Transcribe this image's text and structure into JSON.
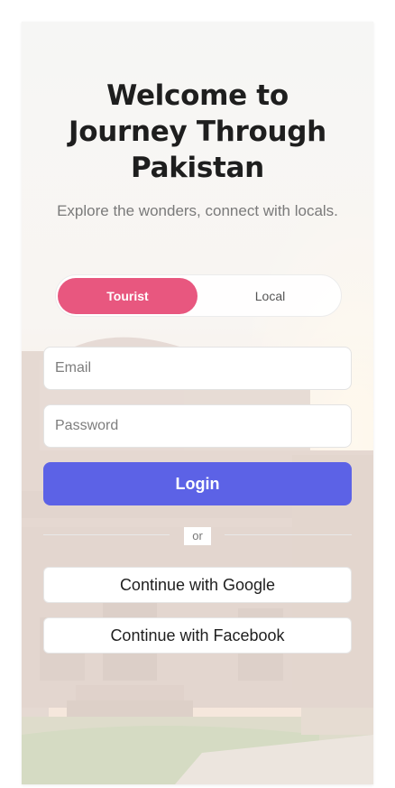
{
  "header": {
    "title_line1": "Welcome to",
    "title_line2": "Journey Through",
    "title_line3": "Pakistan",
    "subtitle": "Explore the wonders, connect with locals."
  },
  "role_toggle": {
    "tourist_label": "Tourist",
    "local_label": "Local",
    "selected": "Tourist"
  },
  "form": {
    "email_placeholder": "Email",
    "password_placeholder": "Password",
    "login_label": "Login",
    "divider_text": "or"
  },
  "social": {
    "google_label": "Continue with Google",
    "facebook_label": "Continue with Facebook"
  },
  "colors": {
    "accent_pink": "#e8577f",
    "primary_blue": "#5c62e6"
  }
}
